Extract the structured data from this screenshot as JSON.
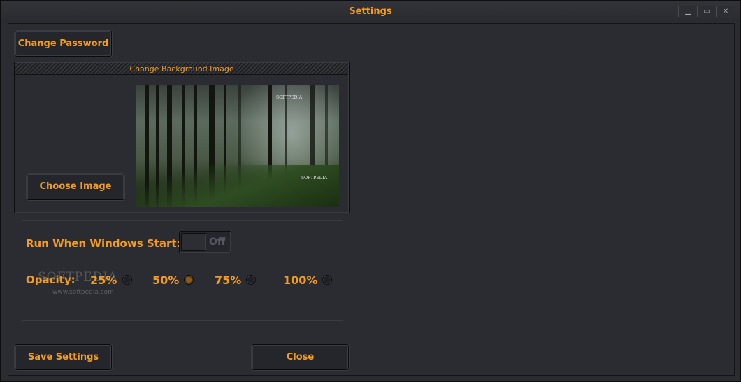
{
  "window": {
    "title": "Settings",
    "controls": {
      "minimize": "▁",
      "maximize": "▭",
      "close": "✕"
    }
  },
  "buttons": {
    "change_password": "Change Password",
    "choose_image": "Choose Image",
    "save_settings": "Save Settings",
    "close": "Close"
  },
  "background_group": {
    "header": "Change Background Image",
    "preview_watermark_top": "SOFTPEDIA",
    "preview_watermark_bottom": "SOFTPEDIA"
  },
  "startup": {
    "label": "Run When Windows Start:",
    "toggle_state": "Off"
  },
  "opacity": {
    "label": "Opacity:",
    "options": [
      "25%",
      "50%",
      "75%",
      "100%"
    ],
    "selected": "50%"
  },
  "watermark": {
    "text": "SOFTPEDIA",
    "url": "www.softpedia.com"
  },
  "colors": {
    "accent": "#f39c1f",
    "background": "#2b2c31",
    "selected_radio": "#8e5a1c"
  }
}
